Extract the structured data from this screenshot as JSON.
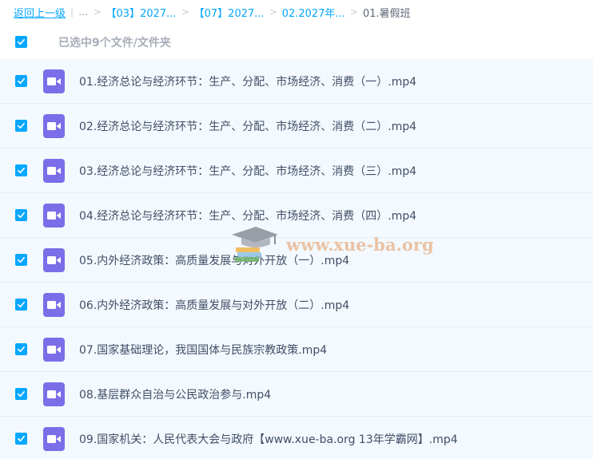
{
  "breadcrumb": {
    "back": "返回上一级",
    "divider": "|",
    "ellipsis": "...",
    "separator": ">",
    "items": [
      "【03】2027...",
      "【07】2027...",
      "02.2027年..."
    ],
    "current": "01.暑假班"
  },
  "selection": {
    "label": "已选中9个文件/文件夹",
    "all_checked": true
  },
  "files": [
    {
      "name": "01.经济总论与经济环节：生产、分配、市场经济、消费（一）.mp4",
      "checked": true,
      "icon": "video-file-icon"
    },
    {
      "name": "02.经济总论与经济环节：生产、分配、市场经济、消费（二）.mp4",
      "checked": true,
      "icon": "video-file-icon"
    },
    {
      "name": "03.经济总论与经济环节：生产、分配、市场经济、消费（三）.mp4",
      "checked": true,
      "icon": "video-file-icon"
    },
    {
      "name": "04.经济总论与经济环节：生产、分配、市场经济、消费（四）.mp4",
      "checked": true,
      "icon": "video-file-icon"
    },
    {
      "name": "05.内外经济政策：高质量发展与对外开放（一）.mp4",
      "checked": true,
      "icon": "video-file-icon"
    },
    {
      "name": "06.内外经济政策：高质量发展与对外开放（二）.mp4",
      "checked": true,
      "icon": "video-file-icon"
    },
    {
      "name": "07.国家基础理论，我国国体与民族宗教政策.mp4",
      "checked": true,
      "icon": "video-file-icon"
    },
    {
      "name": "08.基层群众自治与公民政治参与.mp4",
      "checked": true,
      "icon": "video-file-icon"
    },
    {
      "name": "09.国家机关：人民代表大会与政府【www.xue-ba.org 13年学霸网】.mp4",
      "checked": true,
      "icon": "video-file-icon"
    }
  ],
  "watermark": {
    "text": "www.xue-ba.org"
  },
  "colors": {
    "accent": "#06a7ff",
    "row_bg": "#f3f9fe",
    "video_icon": "#7b6ee8",
    "text": "#424e67"
  }
}
